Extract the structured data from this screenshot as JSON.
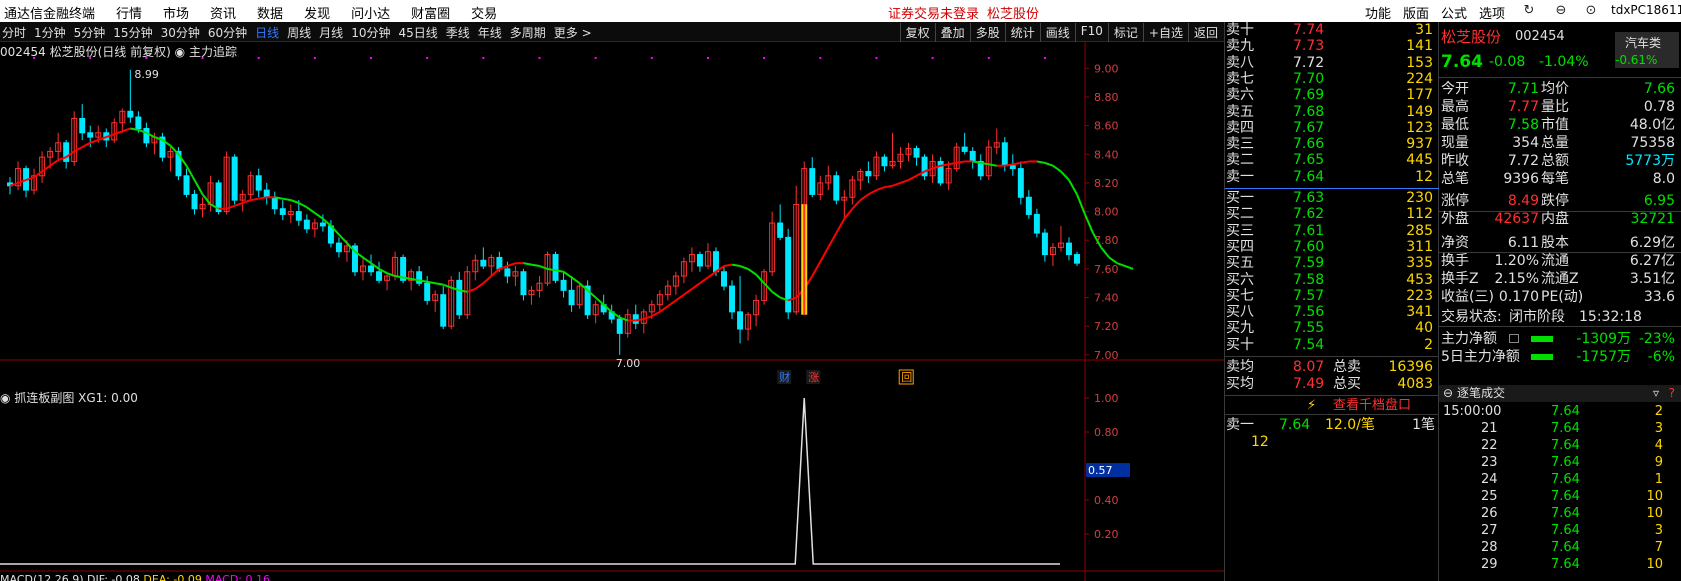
{
  "app": {
    "title": "通达信金融终端",
    "menus": [
      "行情",
      "市场",
      "资讯",
      "数据",
      "发现",
      "问小达",
      "财富圈",
      "交易"
    ],
    "alert": "证券交易未登录",
    "stock_link": "松芝股份",
    "right_menus": [
      "功能",
      "版面",
      "公式",
      "选项"
    ],
    "user": "tdxPC18611"
  },
  "toolbar": {
    "periods": [
      "分时",
      "1分钟",
      "5分钟",
      "15分钟",
      "30分钟",
      "60分钟",
      "日线",
      "周线",
      "月线",
      "10分钟",
      "45日线",
      "季线",
      "年线",
      "多周期",
      "更多 >"
    ],
    "active": "日线",
    "tools": [
      "复权",
      "叠加",
      "多股",
      "统计",
      "画线",
      "F10",
      "标记",
      "+自选",
      "返回"
    ]
  },
  "chart": {
    "header": "002454 松芝股份(日线 前复权)",
    "indicator": "主力追踪",
    "high_label": "8.99",
    "low_label": "7.00",
    "y_labels": [
      "9.00",
      "8.80",
      "8.60",
      "8.40",
      "8.20",
      "8.00",
      "7.80",
      "7.60",
      "7.40",
      "7.20",
      "7.00"
    ],
    "markers": [
      "财",
      "涨",
      "回"
    ]
  },
  "sub_chart": {
    "header": "抓连板副图  XG1: 0.00",
    "y_labels": [
      "1.00",
      "0.80",
      "0.57",
      "0.40",
      "0.20"
    ],
    "current": "0.57"
  },
  "macd": {
    "label": "MACD(12,26,9)",
    "dif": "DIF: -0.08",
    "dea": "DEA: -0.09",
    "macd": "MACD: 0.16"
  },
  "chart_data": {
    "type": "candlestick",
    "ylim": [
      6.95,
      9.1
    ],
    "ohlc": [
      [
        8.2,
        8.24,
        8.12,
        8.18
      ],
      [
        8.18,
        8.35,
        8.15,
        8.3
      ],
      [
        8.3,
        8.32,
        8.1,
        8.15
      ],
      [
        8.15,
        8.3,
        8.12,
        8.25
      ],
      [
        8.25,
        8.42,
        8.2,
        8.38
      ],
      [
        8.38,
        8.45,
        8.3,
        8.42
      ],
      [
        8.42,
        8.55,
        8.35,
        8.48
      ],
      [
        8.48,
        8.5,
        8.3,
        8.35
      ],
      [
        8.35,
        8.7,
        8.32,
        8.65
      ],
      [
        8.65,
        8.75,
        8.5,
        8.55
      ],
      [
        8.55,
        8.6,
        8.45,
        8.52
      ],
      [
        8.52,
        8.6,
        8.48,
        8.55
      ],
      [
        8.55,
        8.58,
        8.45,
        8.5
      ],
      [
        8.5,
        8.65,
        8.48,
        8.62
      ],
      [
        8.62,
        8.72,
        8.55,
        8.7
      ],
      [
        8.7,
        8.99,
        8.62,
        8.66
      ],
      [
        8.66,
        8.7,
        8.55,
        8.58
      ],
      [
        8.58,
        8.62,
        8.45,
        8.48
      ],
      [
        8.48,
        8.55,
        8.4,
        8.52
      ],
      [
        8.52,
        8.55,
        8.35,
        8.38
      ],
      [
        8.38,
        8.45,
        8.28,
        8.42
      ],
      [
        8.42,
        8.45,
        8.22,
        8.25
      ],
      [
        8.25,
        8.3,
        8.1,
        8.12
      ],
      [
        8.12,
        8.15,
        7.98,
        8.02
      ],
      [
        8.02,
        8.1,
        7.96,
        8.05
      ],
      [
        8.05,
        8.25,
        8.0,
        8.2
      ],
      [
        8.2,
        8.22,
        7.98,
        8.0
      ],
      [
        8.0,
        8.42,
        7.98,
        8.38
      ],
      [
        8.38,
        8.4,
        8.05,
        8.08
      ],
      [
        8.08,
        8.15,
        8.0,
        8.12
      ],
      [
        8.12,
        8.28,
        8.08,
        8.25
      ],
      [
        8.25,
        8.3,
        8.1,
        8.15
      ],
      [
        8.15,
        8.2,
        8.05,
        8.1
      ],
      [
        8.1,
        8.14,
        7.98,
        8.02
      ],
      [
        8.02,
        8.08,
        7.94,
        7.98
      ],
      [
        7.98,
        8.05,
        7.92,
        8.0
      ],
      [
        8.0,
        8.08,
        7.9,
        7.94
      ],
      [
        7.94,
        7.98,
        7.85,
        7.88
      ],
      [
        7.88,
        7.95,
        7.82,
        7.92
      ],
      [
        7.92,
        7.98,
        7.86,
        7.9
      ],
      [
        7.9,
        7.94,
        7.75,
        7.78
      ],
      [
        7.78,
        7.82,
        7.68,
        7.72
      ],
      [
        7.72,
        7.8,
        7.65,
        7.76
      ],
      [
        7.76,
        7.78,
        7.55,
        7.58
      ],
      [
        7.58,
        7.68,
        7.52,
        7.62
      ],
      [
        7.62,
        7.7,
        7.55,
        7.58
      ],
      [
        7.58,
        7.65,
        7.5,
        7.52
      ],
      [
        7.52,
        7.58,
        7.45,
        7.55
      ],
      [
        7.55,
        7.72,
        7.52,
        7.68
      ],
      [
        7.68,
        7.7,
        7.5,
        7.52
      ],
      [
        7.52,
        7.6,
        7.45,
        7.58
      ],
      [
        7.58,
        7.62,
        7.48,
        7.5
      ],
      [
        7.5,
        7.55,
        7.35,
        7.38
      ],
      [
        7.38,
        7.45,
        7.3,
        7.42
      ],
      [
        7.42,
        7.48,
        7.18,
        7.2
      ],
      [
        7.2,
        7.55,
        7.18,
        7.52
      ],
      [
        7.52,
        7.58,
        7.25,
        7.28
      ],
      [
        7.28,
        7.62,
        7.25,
        7.58
      ],
      [
        7.58,
        7.7,
        7.52,
        7.66
      ],
      [
        7.66,
        7.75,
        7.6,
        7.62
      ],
      [
        7.62,
        7.7,
        7.55,
        7.68
      ],
      [
        7.68,
        7.72,
        7.58,
        7.6
      ],
      [
        7.6,
        7.65,
        7.5,
        7.55
      ],
      [
        7.55,
        7.62,
        7.48,
        7.58
      ],
      [
        7.58,
        7.6,
        7.38,
        7.42
      ],
      [
        7.42,
        7.48,
        7.35,
        7.45
      ],
      [
        7.45,
        7.55,
        7.4,
        7.5
      ],
      [
        7.5,
        7.72,
        7.48,
        7.7
      ],
      [
        7.7,
        7.72,
        7.5,
        7.52
      ],
      [
        7.52,
        7.58,
        7.4,
        7.45
      ],
      [
        7.45,
        7.55,
        7.3,
        7.35
      ],
      [
        7.35,
        7.5,
        7.32,
        7.48
      ],
      [
        7.48,
        7.52,
        7.25,
        7.28
      ],
      [
        7.28,
        7.38,
        7.22,
        7.35
      ],
      [
        7.35,
        7.42,
        7.28,
        7.3
      ],
      [
        7.3,
        7.35,
        7.22,
        7.25
      ],
      [
        7.25,
        7.28,
        7.0,
        7.15
      ],
      [
        7.15,
        7.32,
        7.12,
        7.28
      ],
      [
        7.28,
        7.35,
        7.18,
        7.22
      ],
      [
        7.22,
        7.32,
        7.15,
        7.3
      ],
      [
        7.3,
        7.38,
        7.25,
        7.35
      ],
      [
        7.35,
        7.45,
        7.3,
        7.42
      ],
      [
        7.42,
        7.52,
        7.38,
        7.48
      ],
      [
        7.48,
        7.58,
        7.42,
        7.55
      ],
      [
        7.55,
        7.68,
        7.5,
        7.65
      ],
      [
        7.65,
        7.75,
        7.58,
        7.7
      ],
      [
        7.7,
        7.72,
        7.58,
        7.62
      ],
      [
        7.62,
        7.78,
        7.6,
        7.72
      ],
      [
        7.72,
        7.75,
        7.55,
        7.58
      ],
      [
        7.58,
        7.62,
        7.45,
        7.48
      ],
      [
        7.48,
        7.52,
        7.25,
        7.3
      ],
      [
        7.3,
        7.55,
        7.08,
        7.18
      ],
      [
        7.18,
        7.3,
        7.1,
        7.28
      ],
      [
        7.28,
        7.42,
        7.2,
        7.38
      ],
      [
        7.38,
        7.6,
        7.35,
        7.58
      ],
      [
        7.58,
        8.0,
        7.55,
        7.92
      ],
      [
        7.92,
        8.05,
        7.8,
        7.82
      ],
      [
        7.82,
        7.88,
        7.25,
        7.3
      ],
      [
        7.3,
        8.18,
        7.28,
        8.05
      ],
      [
        8.05,
        8.35,
        8.0,
        8.3
      ],
      [
        8.3,
        8.38,
        8.1,
        8.12
      ],
      [
        8.12,
        8.25,
        8.08,
        8.2
      ],
      [
        8.2,
        8.32,
        8.15,
        8.25
      ],
      [
        8.25,
        8.28,
        8.05,
        8.08
      ],
      [
        8.08,
        8.15,
        7.95,
        8.1
      ],
      [
        8.1,
        8.25,
        8.05,
        8.22
      ],
      [
        8.22,
        8.3,
        8.15,
        8.28
      ],
      [
        8.28,
        8.35,
        8.2,
        8.25
      ],
      [
        8.25,
        8.42,
        8.22,
        8.38
      ],
      [
        8.38,
        8.4,
        8.28,
        8.32
      ],
      [
        8.32,
        8.55,
        8.3,
        8.35
      ],
      [
        8.35,
        8.45,
        8.3,
        8.4
      ],
      [
        8.4,
        8.48,
        8.35,
        8.44
      ],
      [
        8.44,
        8.46,
        8.32,
        8.38
      ],
      [
        8.38,
        8.4,
        8.22,
        8.25
      ],
      [
        8.25,
        8.4,
        8.2,
        8.35
      ],
      [
        8.35,
        8.38,
        8.18,
        8.2
      ],
      [
        8.2,
        8.35,
        8.15,
        8.3
      ],
      [
        8.3,
        8.48,
        8.28,
        8.45
      ],
      [
        8.45,
        8.55,
        8.4,
        8.42
      ],
      [
        8.42,
        8.45,
        8.3,
        8.35
      ],
      [
        8.35,
        8.4,
        8.22,
        8.25
      ],
      [
        8.25,
        8.5,
        8.22,
        8.45
      ],
      [
        8.45,
        8.58,
        8.4,
        8.48
      ],
      [
        8.48,
        8.52,
        8.28,
        8.32
      ],
      [
        8.32,
        8.4,
        8.25,
        8.3
      ],
      [
        8.3,
        8.35,
        8.05,
        8.1
      ],
      [
        8.1,
        8.15,
        7.95,
        7.98
      ],
      [
        7.98,
        8.02,
        7.82,
        7.85
      ],
      [
        7.85,
        7.88,
        7.65,
        7.7
      ],
      [
        7.7,
        7.78,
        7.62,
        7.75
      ],
      [
        7.75,
        7.9,
        7.72,
        7.78
      ],
      [
        7.78,
        7.82,
        7.66,
        7.7
      ],
      [
        7.7,
        7.72,
        7.62,
        7.64
      ]
    ],
    "ma": [
      8.18,
      8.2,
      8.22,
      8.24,
      8.28,
      8.32,
      8.36,
      8.38,
      8.42,
      8.45,
      8.48,
      8.5,
      8.52,
      8.54,
      8.56,
      8.58,
      8.57,
      8.55,
      8.52,
      8.5,
      8.46,
      8.4,
      8.32,
      8.22,
      8.12,
      8.05,
      8.02,
      8.02,
      8.04,
      8.06,
      8.08,
      8.09,
      8.1,
      8.1,
      8.09,
      8.08,
      8.06,
      8.03,
      7.99,
      7.95,
      7.9,
      7.84,
      7.78,
      7.72,
      7.68,
      7.64,
      7.6,
      7.57,
      7.55,
      7.54,
      7.53,
      7.52,
      7.51,
      7.5,
      7.49,
      7.47,
      7.45,
      7.44,
      7.46,
      7.5,
      7.55,
      7.6,
      7.62,
      7.64,
      7.64,
      7.63,
      7.62,
      7.6,
      7.59,
      7.58,
      7.54,
      7.5,
      7.45,
      7.4,
      7.35,
      7.3,
      7.26,
      7.24,
      7.24,
      7.25,
      7.27,
      7.3,
      7.34,
      7.38,
      7.42,
      7.46,
      7.5,
      7.54,
      7.58,
      7.62,
      7.63,
      7.62,
      7.6,
      7.56,
      7.5,
      7.44,
      7.4,
      7.38,
      7.4,
      7.46,
      7.55,
      7.65,
      7.75,
      7.85,
      7.95,
      8.02,
      8.08,
      8.12,
      8.15,
      8.17,
      8.18,
      8.2,
      8.22,
      8.25,
      8.28,
      8.3,
      8.32,
      8.33,
      8.34,
      8.35,
      8.35,
      8.34,
      8.33,
      8.32,
      8.32,
      8.33,
      8.34,
      8.35,
      8.35,
      8.34,
      8.32,
      8.28,
      8.22,
      8.12,
      7.98,
      7.85,
      7.75,
      7.68,
      7.64,
      7.62,
      7.6
    ],
    "xg1_spike_index": 99
  },
  "orderbook": {
    "asks": [
      {
        "label": "卖十",
        "price": "7.74",
        "vol": "31"
      },
      {
        "label": "卖九",
        "price": "7.73",
        "vol": "141"
      },
      {
        "label": "卖八",
        "price": "7.72",
        "vol": "153"
      },
      {
        "label": "卖七",
        "price": "7.70",
        "vol": "224"
      },
      {
        "label": "卖六",
        "price": "7.69",
        "vol": "177"
      },
      {
        "label": "卖五",
        "price": "7.68",
        "vol": "149"
      },
      {
        "label": "卖四",
        "price": "7.67",
        "vol": "123"
      },
      {
        "label": "卖三",
        "price": "7.66",
        "vol": "937"
      },
      {
        "label": "卖二",
        "price": "7.65",
        "vol": "445"
      },
      {
        "label": "卖一",
        "price": "7.64",
        "vol": "12"
      }
    ],
    "bids": [
      {
        "label": "买一",
        "price": "7.63",
        "vol": "230"
      },
      {
        "label": "买二",
        "price": "7.62",
        "vol": "112"
      },
      {
        "label": "买三",
        "price": "7.61",
        "vol": "285"
      },
      {
        "label": "买四",
        "price": "7.60",
        "vol": "311"
      },
      {
        "label": "买五",
        "price": "7.59",
        "vol": "335"
      },
      {
        "label": "买六",
        "price": "7.58",
        "vol": "453"
      },
      {
        "label": "买七",
        "price": "7.57",
        "vol": "223"
      },
      {
        "label": "买八",
        "price": "7.56",
        "vol": "341"
      },
      {
        "label": "买九",
        "price": "7.55",
        "vol": "40"
      },
      {
        "label": "买十",
        "price": "7.54",
        "vol": "2"
      }
    ],
    "avg_sell_label": "卖均",
    "avg_sell": "8.07",
    "total_sell_label": "总卖",
    "total_sell": "16396",
    "avg_buy_label": "买均",
    "avg_buy": "7.49",
    "total_buy_label": "总买",
    "total_buy": "4083",
    "qiandang": "查看千档盘口",
    "sell1_label": "卖一",
    "sell1_price": "7.64",
    "sell1_per": "12.0/笔",
    "sell1_cnt": "1笔",
    "sell1_vol": "12"
  },
  "quote": {
    "name": "松芝股份",
    "code": "002454",
    "sector": "汽车类",
    "sector_chg": "-0.61%",
    "price": "7.64",
    "chg": "-0.08",
    "pct": "-1.04%",
    "rows": [
      [
        "今开",
        "7.71",
        "均价",
        "7.66"
      ],
      [
        "最高",
        "7.77",
        "量比",
        "0.78"
      ],
      [
        "最低",
        "7.58",
        "市值",
        "48.0亿"
      ],
      [
        "现量",
        "354",
        "总量",
        "75358"
      ],
      [
        "昨收",
        "7.72",
        "总额",
        "5773万"
      ],
      [
        "总笔",
        "9396",
        "每笔",
        "8.0"
      ],
      [
        "涨停",
        "8.49",
        "跌停",
        "6.95"
      ],
      [
        "外盘",
        "42637",
        "内盘",
        "32721"
      ],
      [
        "净资",
        "6.11",
        "股本",
        "6.29亿"
      ],
      [
        "换手",
        "1.20%",
        "流通",
        "6.27亿"
      ],
      [
        "换手Z",
        "2.15%",
        "流通Z",
        "3.51亿"
      ],
      [
        "收益(三)",
        "0.170",
        "PE(动)",
        "33.6"
      ]
    ],
    "status_label": "交易状态:",
    "status": "闭市阶段",
    "time": "15:32:18",
    "main_flow_label": "主力净额",
    "main_flow": "-1309万",
    "main_flow_pct": "-23%",
    "flow5_label": "5日主力净额",
    "flow5": "-1757万",
    "flow5_pct": "-6%"
  },
  "trades": {
    "title": "逐笔成交",
    "rows": [
      [
        "15:00:00",
        "7.64",
        "2"
      ],
      [
        "21",
        "7.64",
        "3"
      ],
      [
        "22",
        "7.64",
        "4"
      ],
      [
        "23",
        "7.64",
        "9"
      ],
      [
        "24",
        "7.64",
        "1"
      ],
      [
        "25",
        "7.64",
        "10"
      ],
      [
        "26",
        "7.64",
        "10"
      ],
      [
        "27",
        "7.64",
        "3"
      ],
      [
        "28",
        "7.64",
        "7"
      ],
      [
        "29",
        "7.64",
        "10"
      ]
    ]
  },
  "colors": {
    "up": "#ff3030",
    "down": "#00e8ff",
    "ma": "#00e000",
    "ma_up": "#ff0000",
    "bg": "#000000"
  }
}
